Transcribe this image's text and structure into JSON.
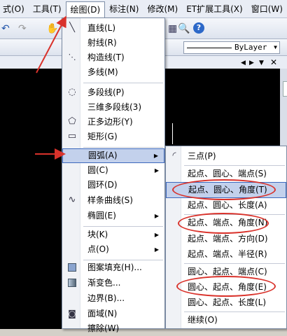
{
  "menubar": {
    "items": [
      "式(O)",
      "工具(T)",
      "绘图(D)",
      "标注(N)",
      "修改(M)",
      "ET扩展工具(X)",
      "窗口(W)"
    ]
  },
  "toolbar": {
    "bylayer": "ByLayer"
  },
  "draw_menu": {
    "items": [
      {
        "label": "直线(L)",
        "icon": "line-icon"
      },
      {
        "label": "射线(R)",
        "icon": ""
      },
      {
        "label": "构造线(T)",
        "icon": "construction-line-icon"
      },
      {
        "label": "多线(M)",
        "icon": ""
      },
      {
        "label": "多段线(P)",
        "icon": "polyline-icon"
      },
      {
        "label": "三维多段线(3)",
        "icon": ""
      },
      {
        "label": "正多边形(Y)",
        "icon": "polygon-icon"
      },
      {
        "label": "矩形(G)",
        "icon": "rectangle-icon"
      },
      {
        "label": "圆弧(A)",
        "icon": ""
      },
      {
        "label": "圆(C)",
        "icon": ""
      },
      {
        "label": "圆环(D)",
        "icon": ""
      },
      {
        "label": "样条曲线(S)",
        "icon": "spline-icon"
      },
      {
        "label": "椭圆(E)",
        "icon": ""
      },
      {
        "label": "块(K)",
        "icon": ""
      },
      {
        "label": "点(O)",
        "icon": ""
      },
      {
        "label": "图案填充(H)...",
        "icon": "hatch-icon"
      },
      {
        "label": "渐变色...",
        "icon": "gradient-icon"
      },
      {
        "label": "边界(B)...",
        "icon": ""
      },
      {
        "label": "面域(N)",
        "icon": "region-icon"
      },
      {
        "label": "擦除(W)",
        "icon": ""
      }
    ]
  },
  "arc_submenu": {
    "items": [
      {
        "label": "三点(P)",
        "icon": "arc-3point-icon"
      },
      {
        "label": "起点、圆心、端点(S)"
      },
      {
        "label": "起点、圆心、角度(T)"
      },
      {
        "label": "起点、圆心、长度(A)"
      },
      {
        "label": "起点、端点、角度(N)"
      },
      {
        "label": "起点、端点、方向(D)"
      },
      {
        "label": "起点、端点、半径(R)"
      },
      {
        "label": "圆心、起点、端点(C)"
      },
      {
        "label": "圆心、起点、角度(E)"
      },
      {
        "label": "圆心、起点、长度(L)"
      },
      {
        "label": "继续(O)"
      }
    ]
  },
  "colors": {
    "annotation_red": "#d9322b",
    "highlight": "#c3d1ec"
  }
}
